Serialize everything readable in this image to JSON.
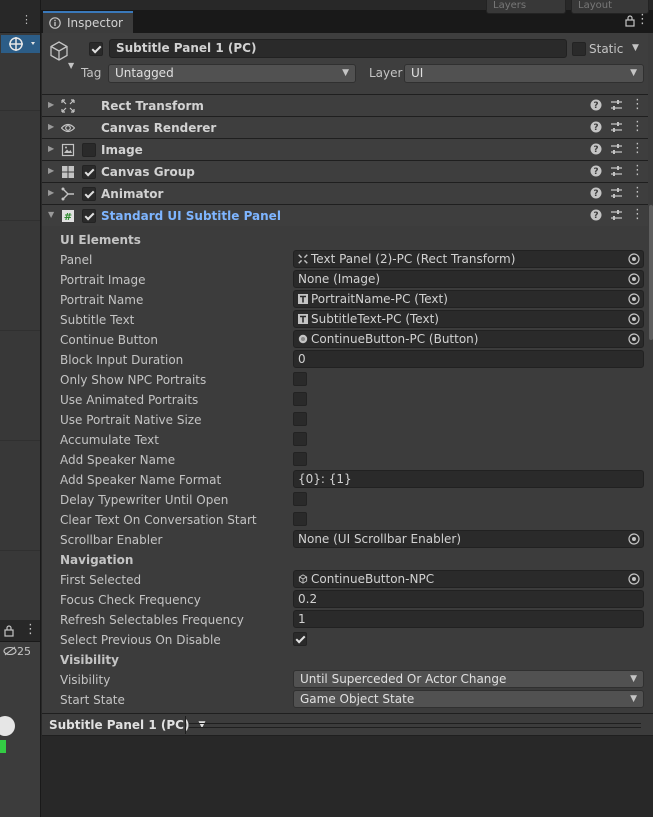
{
  "tab": {
    "title": "Inspector"
  },
  "top_fragments": [
    "Layers",
    "Layout"
  ],
  "left_panel": {
    "counter": "25"
  },
  "gameobject": {
    "name": "Subtitle Panel 1 (PC)",
    "active": true,
    "static_label": "Static",
    "static": false,
    "tag_label": "Tag",
    "tag_value": "Untagged",
    "layer_label": "Layer",
    "layer_value": "UI"
  },
  "components": [
    {
      "name": "Rect Transform",
      "icon": "rect-transform-icon",
      "has_toggle": false,
      "enabled": false,
      "expanded": false
    },
    {
      "name": "Canvas Renderer",
      "icon": "eye-icon",
      "has_toggle": false,
      "enabled": false,
      "expanded": false
    },
    {
      "name": "Image",
      "icon": "image-icon",
      "has_toggle": true,
      "enabled": false,
      "expanded": false
    },
    {
      "name": "Canvas Group",
      "icon": "canvas-group-icon",
      "has_toggle": true,
      "enabled": true,
      "expanded": false
    },
    {
      "name": "Animator",
      "icon": "animator-icon",
      "has_toggle": true,
      "enabled": true,
      "expanded": false
    },
    {
      "name": "Standard UI Subtitle Panel",
      "icon": "script-icon",
      "has_toggle": true,
      "enabled": true,
      "expanded": true
    }
  ],
  "properties": {
    "ui_elements_header": "UI Elements",
    "panel": {
      "label": "Panel",
      "value": "Text Panel (2)-PC (Rect Transform)"
    },
    "portrait_image": {
      "label": "Portrait Image",
      "value": "None (Image)"
    },
    "portrait_name": {
      "label": "Portrait Name",
      "value": "PortraitName-PC (Text)"
    },
    "subtitle_text": {
      "label": "Subtitle Text",
      "value": "SubtitleText-PC (Text)"
    },
    "continue_button": {
      "label": "Continue Button",
      "value": "ContinueButton-PC (Button)"
    },
    "block_input_duration": {
      "label": "Block Input Duration",
      "value": "0"
    },
    "only_show_npc_portraits": {
      "label": "Only Show NPC Portraits",
      "checked": false
    },
    "use_animated_portraits": {
      "label": "Use Animated Portraits",
      "checked": false
    },
    "use_portrait_native_size": {
      "label": "Use Portrait Native Size",
      "checked": false
    },
    "accumulate_text": {
      "label": "Accumulate Text",
      "checked": false
    },
    "add_speaker_name": {
      "label": "Add Speaker Name",
      "checked": false
    },
    "add_speaker_name_format": {
      "label": "Add Speaker Name Format",
      "value": "{0}: {1}"
    },
    "delay_typewriter_until_open": {
      "label": "Delay Typewriter Until Open",
      "checked": false
    },
    "clear_text_on_conversation_start": {
      "label": "Clear Text On Conversation Start",
      "checked": false
    },
    "scrollbar_enabler": {
      "label": "Scrollbar Enabler",
      "value": "None (UI Scrollbar Enabler)"
    },
    "navigation_header": "Navigation",
    "first_selected": {
      "label": "First Selected",
      "value": "ContinueButton-NPC"
    },
    "focus_check_frequency": {
      "label": "Focus Check Frequency",
      "value": "0.2"
    },
    "refresh_selectables_frequency": {
      "label": "Refresh Selectables Frequency",
      "value": "1"
    },
    "select_previous_on_disable": {
      "label": "Select Previous On Disable",
      "checked": true
    },
    "visibility_header": "Visibility",
    "visibility": {
      "label": "Visibility",
      "value": "Until Superceded Or Actor Change"
    },
    "start_state": {
      "label": "Start State",
      "value": "Game Object State"
    }
  },
  "preview": {
    "title": "Subtitle Panel 1 (PC)"
  }
}
